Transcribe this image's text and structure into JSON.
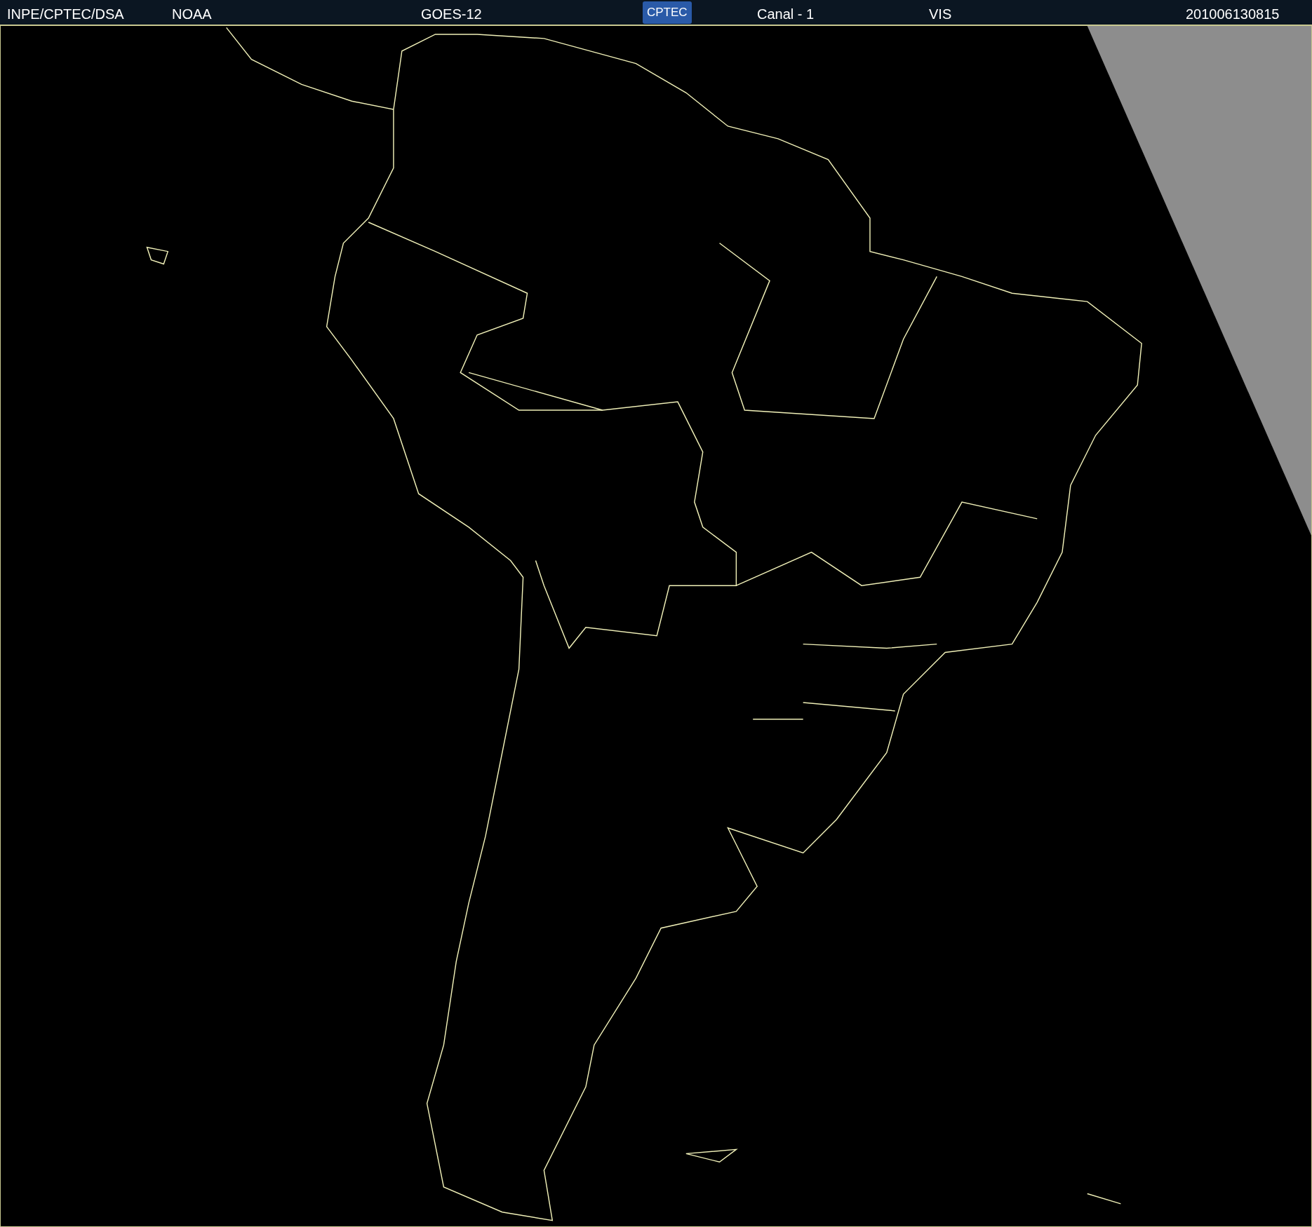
{
  "header": {
    "items": [
      {
        "kind": "text",
        "text": "INPE/CPTEC/DSA"
      },
      {
        "kind": "text",
        "text": "NOAA"
      },
      {
        "kind": "text",
        "text": "GOES-12"
      },
      {
        "kind": "logo",
        "text": "CPTEC"
      },
      {
        "kind": "text",
        "text": "Canal - 1"
      },
      {
        "kind": "text",
        "text": "VIS"
      },
      {
        "kind": "text",
        "text": "201006130815"
      }
    ]
  }
}
